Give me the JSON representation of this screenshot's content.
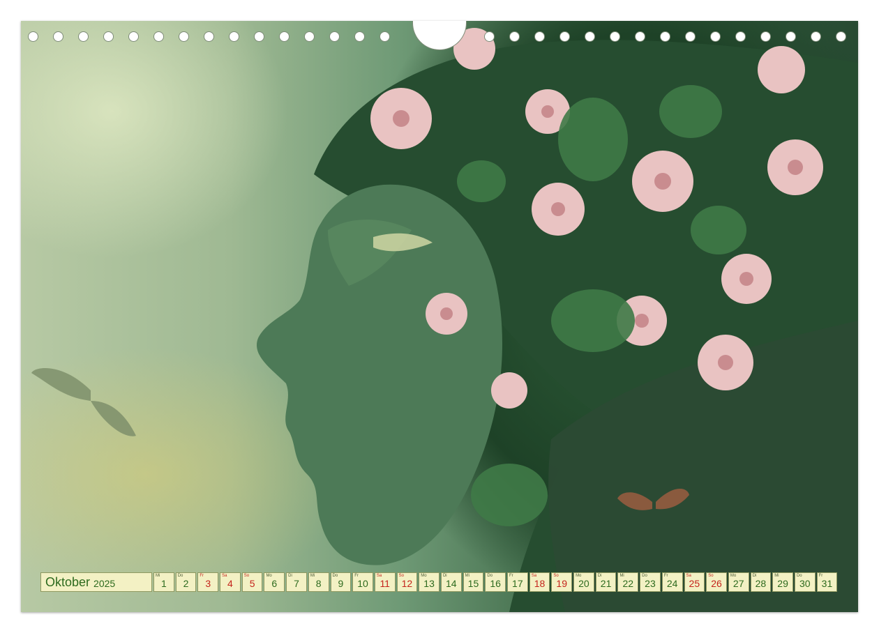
{
  "calendar": {
    "month": "Oktober",
    "year": "2025",
    "days": [
      {
        "wd": "Mi",
        "d": "1",
        "weekend": false
      },
      {
        "wd": "Do",
        "d": "2",
        "weekend": false
      },
      {
        "wd": "Fr",
        "d": "3",
        "weekend": true
      },
      {
        "wd": "Sa",
        "d": "4",
        "weekend": true
      },
      {
        "wd": "So",
        "d": "5",
        "weekend": true
      },
      {
        "wd": "Mo",
        "d": "6",
        "weekend": false
      },
      {
        "wd": "Di",
        "d": "7",
        "weekend": false
      },
      {
        "wd": "Mi",
        "d": "8",
        "weekend": false
      },
      {
        "wd": "Do",
        "d": "9",
        "weekend": false
      },
      {
        "wd": "Fr",
        "d": "10",
        "weekend": false
      },
      {
        "wd": "Sa",
        "d": "11",
        "weekend": true
      },
      {
        "wd": "So",
        "d": "12",
        "weekend": true
      },
      {
        "wd": "Mo",
        "d": "13",
        "weekend": false
      },
      {
        "wd": "Di",
        "d": "14",
        "weekend": false
      },
      {
        "wd": "Mi",
        "d": "15",
        "weekend": false
      },
      {
        "wd": "Do",
        "d": "16",
        "weekend": false
      },
      {
        "wd": "Fr",
        "d": "17",
        "weekend": false
      },
      {
        "wd": "Sa",
        "d": "18",
        "weekend": true
      },
      {
        "wd": "So",
        "d": "19",
        "weekend": true
      },
      {
        "wd": "Mo",
        "d": "20",
        "weekend": false
      },
      {
        "wd": "Di",
        "d": "21",
        "weekend": false
      },
      {
        "wd": "Mi",
        "d": "22",
        "weekend": false
      },
      {
        "wd": "Do",
        "d": "23",
        "weekend": false
      },
      {
        "wd": "Fr",
        "d": "24",
        "weekend": false
      },
      {
        "wd": "Sa",
        "d": "25",
        "weekend": true
      },
      {
        "wd": "So",
        "d": "26",
        "weekend": true
      },
      {
        "wd": "Mo",
        "d": "27",
        "weekend": false
      },
      {
        "wd": "Di",
        "d": "28",
        "weekend": false
      },
      {
        "wd": "Mi",
        "d": "29",
        "weekend": false
      },
      {
        "wd": "Do",
        "d": "30",
        "weekend": false
      },
      {
        "wd": "Fr",
        "d": "31",
        "weekend": false
      }
    ]
  },
  "colors": {
    "cell_background": "#f3f1c4",
    "weekday_text": "#2d6a1e",
    "weekend_text": "#c4241c"
  }
}
